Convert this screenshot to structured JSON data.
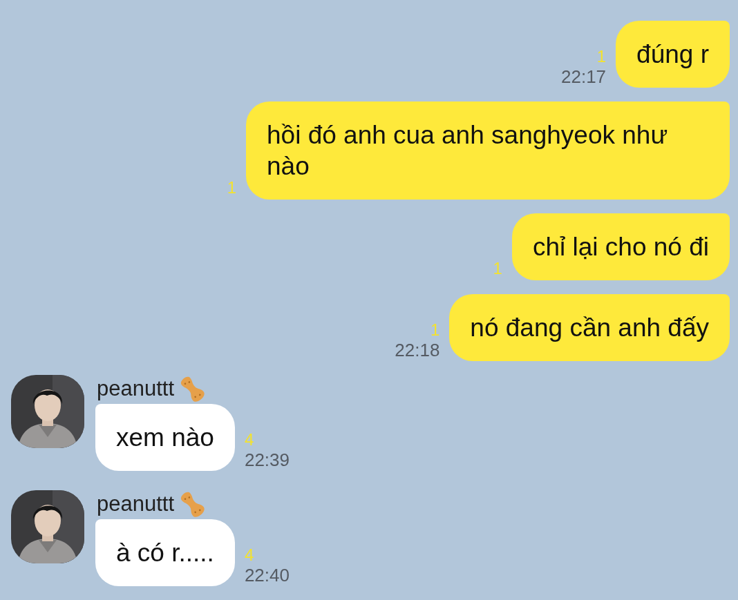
{
  "messages": [
    {
      "kind": "sent",
      "text": "đúng r",
      "unread": "1",
      "time": "22:17"
    },
    {
      "kind": "sent",
      "text": "hồi đó anh cua anh sanghyeok như nào",
      "unread": "1"
    },
    {
      "kind": "sent",
      "text": "chỉ lại cho nó đi",
      "unread": "1"
    },
    {
      "kind": "sent",
      "text": "nó đang cần anh đấy",
      "unread": "1",
      "time": "22:18"
    },
    {
      "kind": "received",
      "sender": "peanuttt",
      "text": "xem nào",
      "unread": "4",
      "time": "22:39"
    },
    {
      "kind": "received",
      "sender": "peanuttt",
      "text": "à có r.....",
      "unread": "4",
      "time": "22:40"
    }
  ]
}
